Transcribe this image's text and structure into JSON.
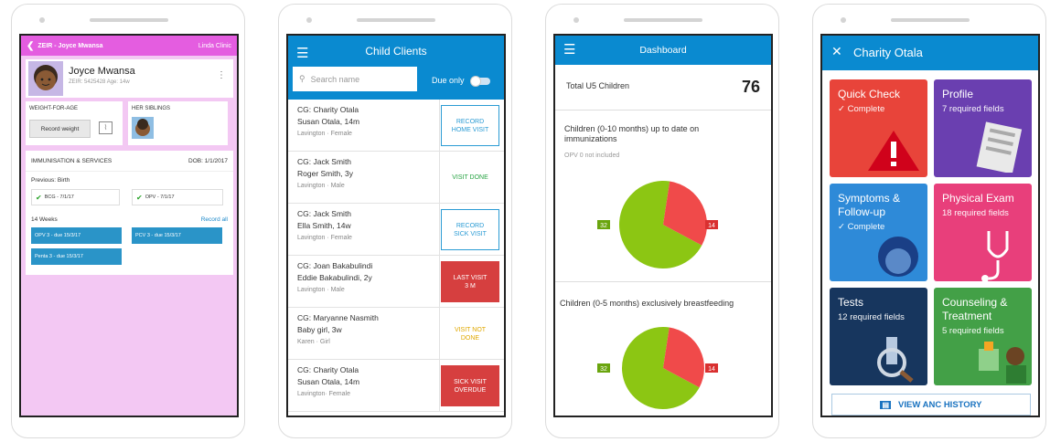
{
  "phone1": {
    "title": "ZEIR - Joyce Mwansa",
    "clinic": "Linda Clinic",
    "name": "Joyce Mwansa",
    "ids": "ZEIR: 5425428  Age: 14w",
    "weight_label": "WEIGHT-FOR-AGE",
    "record_weight": "Record weight",
    "siblings_label": "HER SIBLINGS",
    "imm_label": "IMMUNISATION & SERVICES",
    "dob": "DOB: 1/1/2017",
    "previous": "Previous: Birth",
    "bcg": "BCG - 7/1/17",
    "opv": "OPV - 7/1/17",
    "weeks": "14 Weeks",
    "record_all": "Record all",
    "due1": "OPV 3 - due 15/3/17",
    "due2": "PCV 3 - due 15/3/17",
    "due3": "Penta 3 - due 15/3/17"
  },
  "phone2": {
    "title": "Child Clients",
    "search_placeholder": "Search name",
    "due_only": "Due only",
    "clients": [
      {
        "cg": "CG: Charity Otala",
        "child": "Susan Otala, 14m",
        "loc": "Lavington · Female",
        "action": "RECORD\nHOME VISIT",
        "style": "outline"
      },
      {
        "cg": "CG: Jack Smith",
        "child": "Roger Smith, 3y",
        "loc": "Lavington · Male",
        "action": "VISIT DONE",
        "style": "green"
      },
      {
        "cg": "CG: Jack Smith",
        "child": "Ella Smith, 14w",
        "loc": "Lavington · Female",
        "action": "RECORD\nSICK VISIT",
        "style": "outline"
      },
      {
        "cg": "CG: Joan Bakabulindi",
        "child": "Eddie Bakabulindi, 2y",
        "loc": "Lavington · Male",
        "action": "LAST VISIT\n3 M",
        "style": "red"
      },
      {
        "cg": "CG: Maryanne Nasmith",
        "child": "Baby girl, 3w",
        "loc": "Karen · Girl",
        "action": "VISIT NOT\nDONE",
        "style": "yellow"
      },
      {
        "cg": "CG: Charity Otala",
        "child": "Susan Otala, 14m",
        "loc": "Lavington· Female",
        "action": "SICK VISIT\nOVERDUE",
        "style": "red"
      }
    ]
  },
  "phone3": {
    "title": "Dashboard",
    "total_label": "Total U5 Children",
    "total_value": "76",
    "card1_title": "Children (0-10 months) up to date on immunizations",
    "card1_sub": "OPV 0 not included",
    "card2_title": "Children (0-5 months) exclusively breastfeeding",
    "chart_data": [
      {
        "type": "pie",
        "values": [
          32,
          14
        ],
        "labels": [
          "32",
          "14"
        ],
        "colors": [
          "#8cc613",
          "#f04a4a"
        ]
      },
      {
        "type": "pie",
        "values": [
          32,
          14
        ],
        "labels": [
          "32",
          "14"
        ],
        "colors": [
          "#8cc613",
          "#f04a4a"
        ]
      }
    ]
  },
  "phone4": {
    "title": "Charity Otala",
    "close_icon": "close-icon",
    "tiles": [
      {
        "title": "Quick Check",
        "sub": "✓ Complete",
        "color": "#e8443a"
      },
      {
        "title": "Profile",
        "sub": "7 required fields",
        "color": "#6a3fb0"
      },
      {
        "title": "Symptoms &\nFollow-up",
        "sub": "✓ Complete",
        "color": "#2e8ad8"
      },
      {
        "title": "Physical Exam",
        "sub": "18 required fields",
        "color": "#e83f7b"
      },
      {
        "title": "Tests",
        "sub": "12 required fields",
        "color": "#17365e"
      },
      {
        "title": "Counseling &\nTreatment",
        "sub": "5 required fields",
        "color": "#43a047"
      }
    ],
    "history": "VIEW ANC HISTORY"
  }
}
